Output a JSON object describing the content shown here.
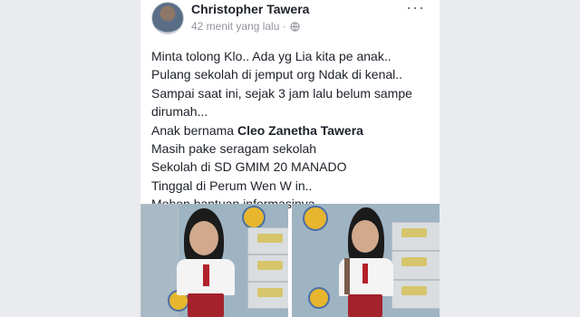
{
  "post": {
    "author": "Christopher Tawera",
    "timestamp": "42 menit yang lalu ·",
    "more_label": "···",
    "lines": [
      "Minta tolong Klo.. Ada yg Lia kita pe anak..",
      "Pulang sekolah di jemput org Ndak di kenal..",
      "Sampai saat ini, sejak 3 jam lalu belum sampe",
      "dirumah..."
    ],
    "name_prefix": "Anak bernama ",
    "child_name": "Cleo Zanetha Tawera",
    "lines_after": [
      "Masih pake seragam sekolah",
      "Sekolah di SD GMIM 20 MANADO",
      "Tinggal di Perum Wen W in..",
      "Mohon bantuan informasinya.."
    ]
  },
  "colors": {
    "page_bg": "#e9ebee",
    "card_bg": "#ffffff",
    "text": "#1d2129",
    "meta": "#90949c"
  },
  "icons": {
    "privacy": "globe-icon",
    "options": "more-options-icon"
  }
}
